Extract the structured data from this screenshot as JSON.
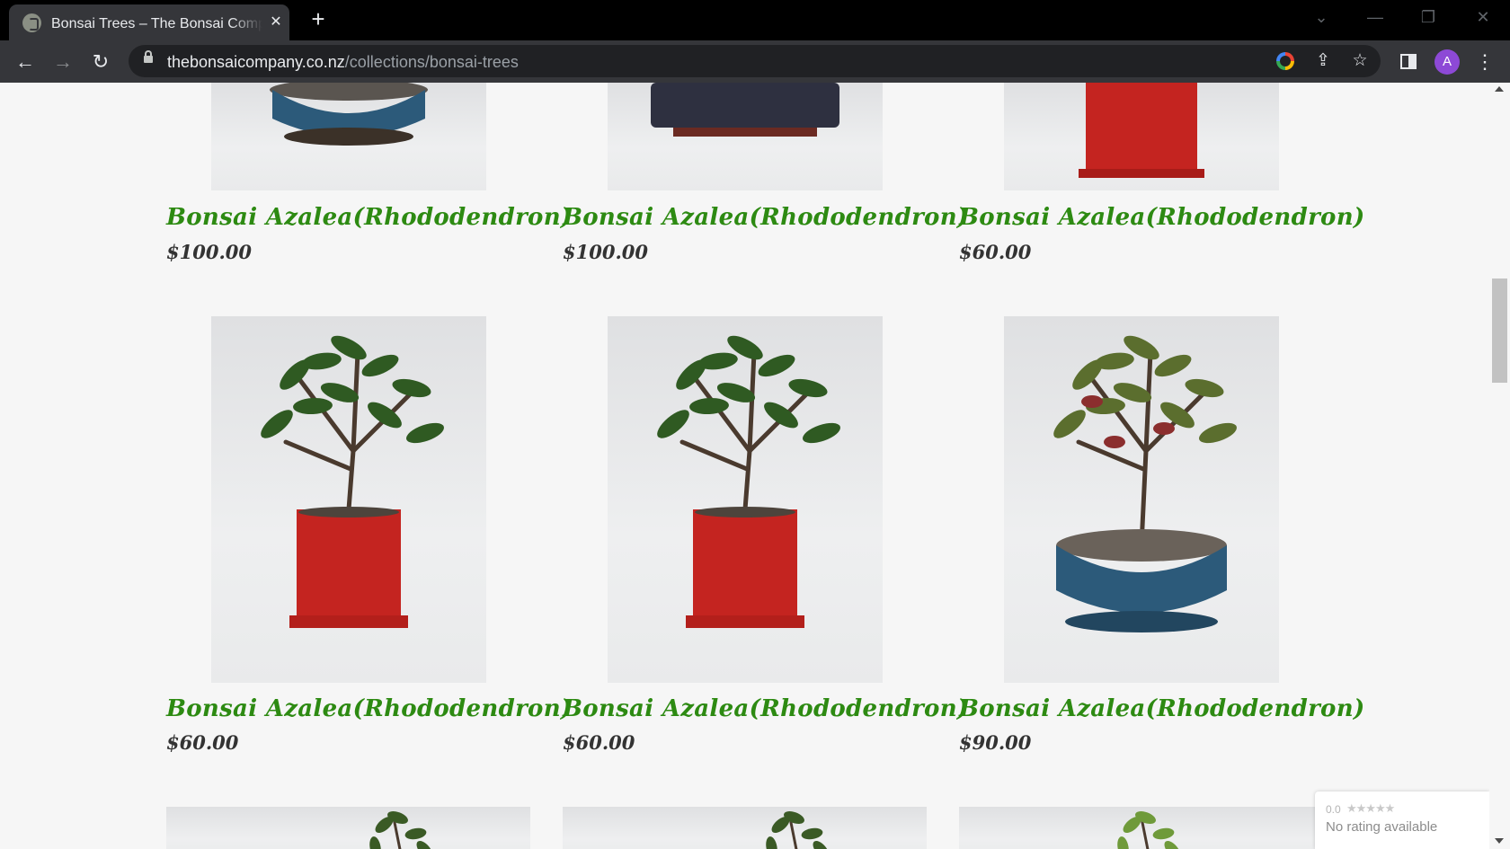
{
  "browser": {
    "tab": {
      "title": "Bonsai Trees – The Bonsai Company",
      "close_glyph": "✕"
    },
    "new_tab_glyph": "+",
    "window_controls": {
      "dropdown": "⌄",
      "minimize": "—",
      "restore": "❐",
      "close": "✕"
    },
    "nav": {
      "back": "←",
      "forward": "→",
      "reload": "↻"
    },
    "address": {
      "host": "thebonsaicompany.co.nz",
      "path": "/collections/bonsai-trees"
    },
    "icons": {
      "share": "⇪",
      "bookmark": "☆",
      "menu": "⋮"
    },
    "profile_initial": "A"
  },
  "products": [
    {
      "title": "Bonsai Azalea(Rhododendron)",
      "price": "$100.00",
      "pot": "round-blue"
    },
    {
      "title": "Bonsai Azalea(Rhododendron)",
      "price": "$100.00",
      "pot": "rect-dark"
    },
    {
      "title": "Bonsai Azalea(Rhododendron)",
      "price": "$60.00",
      "pot": "square-red"
    },
    {
      "title": "Bonsai Azalea(Rhododendron)",
      "price": "$60.00",
      "pot": "square-red"
    },
    {
      "title": "Bonsai Azalea(Rhododendron)",
      "price": "$60.00",
      "pot": "square-red"
    },
    {
      "title": "Bonsai Azalea(Rhododendron)",
      "price": "$90.00",
      "pot": "round-blue"
    }
  ],
  "rating_widget": {
    "score": "0.0",
    "stars": "★★★★★",
    "text": "No rating available"
  },
  "colors": {
    "title_green": "#2d8a12",
    "price_text": "#333333",
    "pot_red": "#c42420",
    "pot_blue": "#2c5a7a"
  }
}
